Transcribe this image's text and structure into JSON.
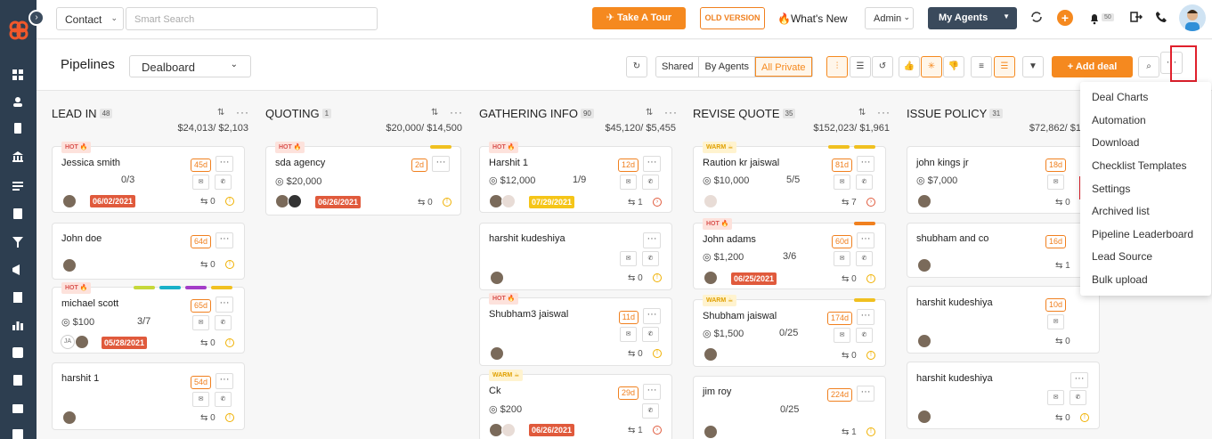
{
  "topbar": {
    "contact_select": "Contact",
    "search_placeholder": "Smart Search",
    "tour_label": "Take A Tour",
    "old_version_label": "OLD VERSION",
    "whats_new_label": "What's New",
    "admin_select": "Admin",
    "agents_select": "My Agents",
    "notif_count": "50"
  },
  "subbar": {
    "title": "Pipelines",
    "board_select": "Dealboard",
    "filters": [
      "Shared",
      "By Agents",
      "All Private"
    ],
    "add_deal_label": "Add deal",
    "more_label": "···"
  },
  "columns": [
    {
      "name": "LEAD IN",
      "count": "48",
      "amount": "$24,013/ $2,103"
    },
    {
      "name": "QUOTING",
      "count": "1",
      "amount": "$20,000/ $14,500"
    },
    {
      "name": "GATHERING INFO",
      "count": "90",
      "amount": "$45,120/ $5,455"
    },
    {
      "name": "REVISE QUOTE",
      "count": "35",
      "amount": "$152,023/ $1,961"
    },
    {
      "name": "ISSUE POLICY",
      "count": "31",
      "amount": "$72,862/ $1"
    }
  ],
  "cards": {
    "c1": {
      "tag": "HOT",
      "name": "Jessica smith",
      "days": "45d",
      "ratio": "0/3",
      "date": "06/02/2021",
      "tasks": "0"
    },
    "c2": {
      "name": "John doe",
      "days": "64d",
      "tasks": "0"
    },
    "c3": {
      "tag": "HOT",
      "name": "michael scott",
      "days": "65d",
      "amount": "$100",
      "ratio": "3/7",
      "date": "05/28/2021",
      "tasks": "0",
      "initials": "JA"
    },
    "c4": {
      "name": "harshit 1",
      "days": "54d",
      "tasks": "0"
    },
    "q1": {
      "tag": "HOT",
      "name": "sda agency",
      "days": "2d",
      "amount": "$20,000",
      "date": "06/26/2021",
      "tasks": "0"
    },
    "g1": {
      "tag": "HOT",
      "name": "Harshit 1",
      "days": "12d",
      "amount": "$12,000",
      "ratio": "1/9",
      "date": "07/29/2021",
      "tasks": "1"
    },
    "g2": {
      "name": "harshit kudeshiya",
      "tasks": "0"
    },
    "g3": {
      "tag": "HOT",
      "name": "Shubham3 jaiswal",
      "days": "11d",
      "tasks": "0"
    },
    "g4": {
      "tag": "WARM",
      "name": "Ck",
      "days": "29d",
      "amount": "$200",
      "date": "06/26/2021",
      "tasks": "1"
    },
    "r1": {
      "tag": "WARM",
      "name": "Raution kr jaiswal",
      "days": "81d",
      "amount": "$10,000",
      "ratio": "5/5",
      "tasks": "7"
    },
    "r2": {
      "tag": "HOT",
      "name": "John adams",
      "days": "60d",
      "amount": "$1,200",
      "ratio": "3/6",
      "date": "06/25/2021",
      "tasks": "0"
    },
    "r3": {
      "tag": "WARM",
      "name": "Shubham jaiswal",
      "days": "174d",
      "amount": "$1,500",
      "ratio": "0/25",
      "tasks": "0"
    },
    "r4": {
      "name": "jim roy",
      "days": "224d",
      "ratio": "0/25",
      "tasks": "1"
    },
    "i1": {
      "name": "john kings jr",
      "days": "18d",
      "amount": "$7,000",
      "tasks": "0"
    },
    "i2": {
      "name": "shubham and co",
      "days": "16d",
      "tasks": "1"
    },
    "i3": {
      "name": "harshit kudeshiya",
      "days": "10d",
      "tasks": "0"
    },
    "i4": {
      "name": "harshit kudeshiya",
      "tasks": "0"
    }
  },
  "menu": {
    "items": [
      "Deal Charts",
      "Automation",
      "Download",
      "Checklist Templates",
      "Settings",
      "Archived list",
      "Pipeline Leaderboard",
      "Lead Source",
      "Bulk upload"
    ]
  }
}
